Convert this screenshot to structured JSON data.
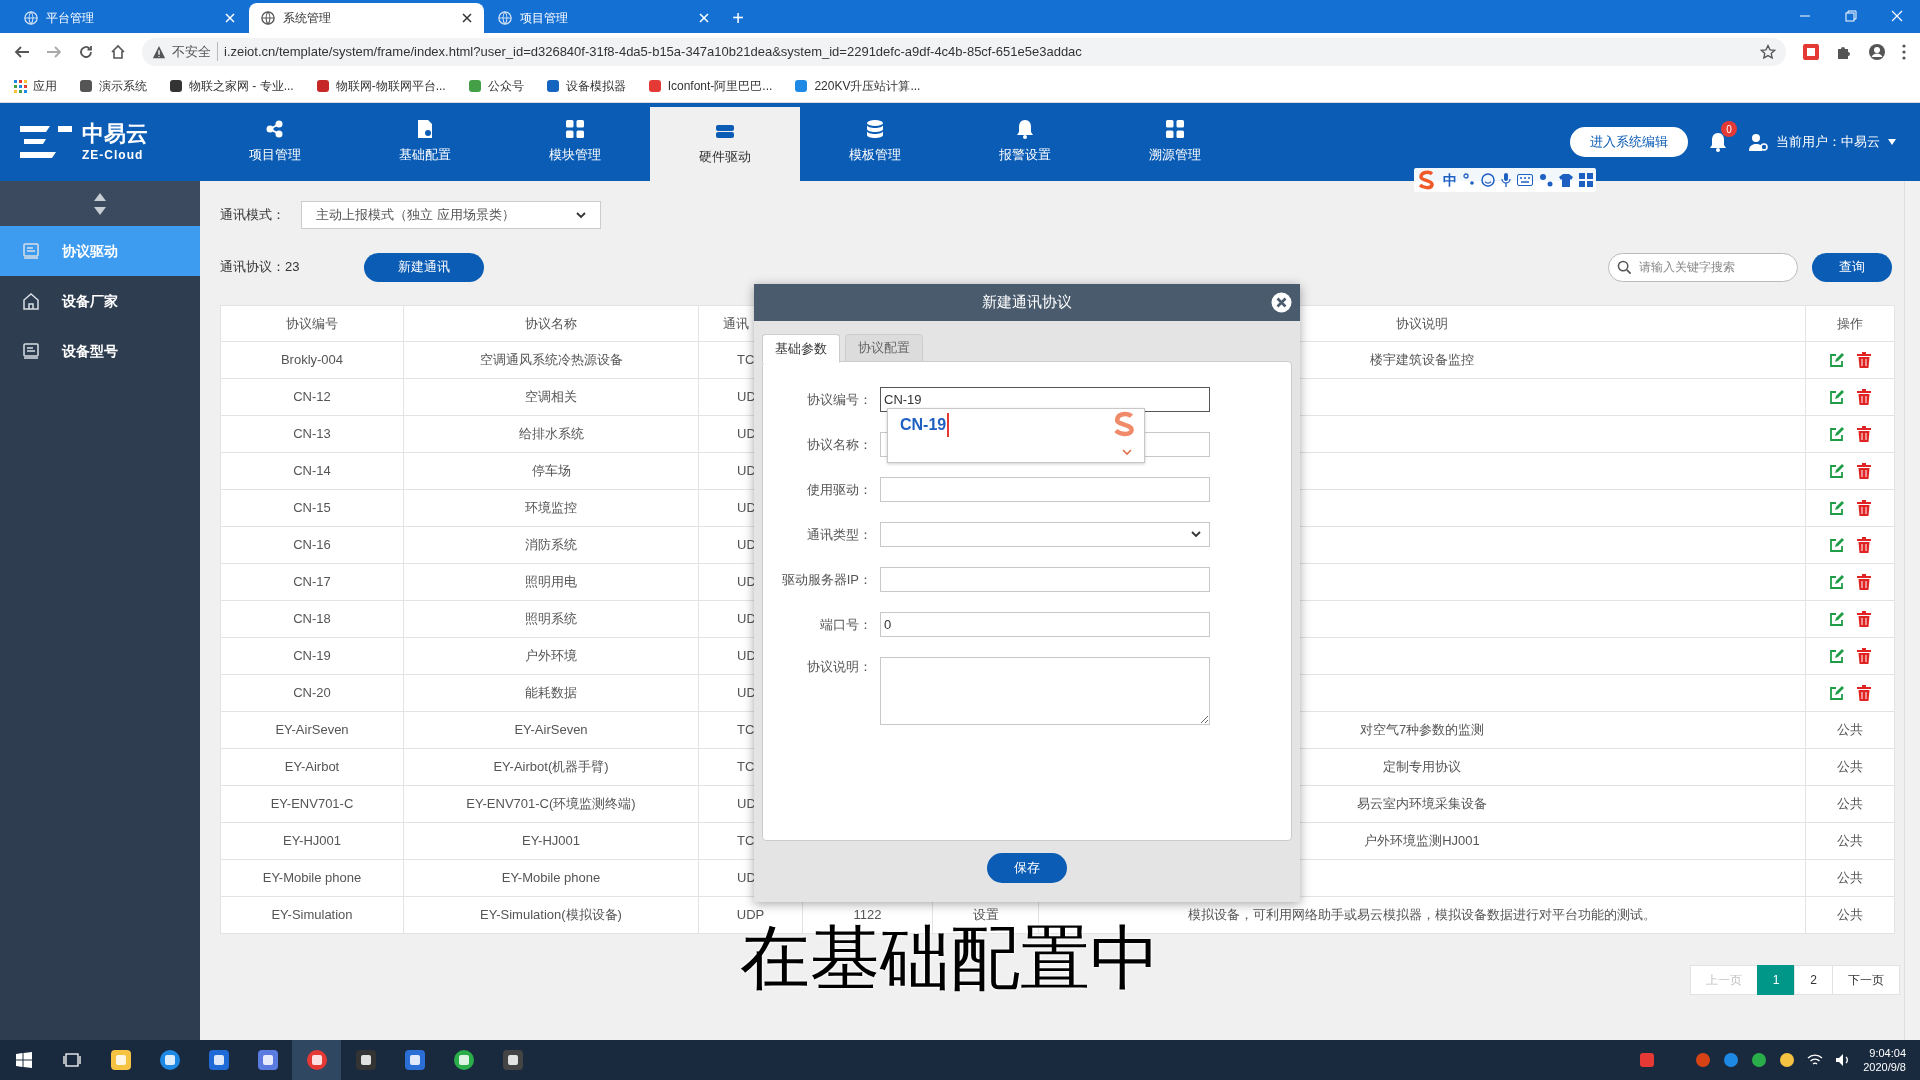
{
  "browser": {
    "tabs": [
      {
        "title": "平台管理",
        "selected": false
      },
      {
        "title": "系统管理",
        "selected": true
      },
      {
        "title": "项目管理",
        "selected": false
      }
    ],
    "new_tab": "+",
    "security_label": "不安全",
    "url": "i.zeiot.cn/template/system/frame/index.html?user_id=d326840f-31f8-4da5-b15a-347a10b21dea&system_id=2291defc-a9df-4c4b-85cf-651e5e3addac",
    "bookmarks": [
      {
        "label": "应用"
      },
      {
        "label": "演示系统"
      },
      {
        "label": "物联之家网 - 专业..."
      },
      {
        "label": "物联网-物联网平台..."
      },
      {
        "label": "公众号"
      },
      {
        "label": "设备模拟器"
      },
      {
        "label": "Iconfont-阿里巴巴..."
      },
      {
        "label": "220KV升压站计算..."
      }
    ]
  },
  "app": {
    "logo_name": "中易云",
    "logo_subtitle": "ZE-Cloud",
    "nav": [
      {
        "label": "项目管理",
        "selected": false
      },
      {
        "label": "基础配置",
        "selected": false
      },
      {
        "label": "模块管理",
        "selected": false
      },
      {
        "label": "硬件驱动",
        "selected": true
      },
      {
        "label": "模板管理",
        "selected": false
      },
      {
        "label": "报警设置",
        "selected": false
      },
      {
        "label": "溯源管理",
        "selected": false
      }
    ],
    "edit_button": "进入系统编辑",
    "notification_count": "0",
    "user_label": "当前用户：中易云"
  },
  "ime_toolbar": {
    "mode": "中"
  },
  "sidebar": {
    "items": [
      {
        "label": "协议驱动",
        "selected": true
      },
      {
        "label": "设备厂家",
        "selected": false
      },
      {
        "label": "设备型号",
        "selected": false
      }
    ]
  },
  "toolbar": {
    "mode_label": "通讯模式：",
    "mode_value": "主动上报模式（独立 应用场景类）",
    "count_label": "通讯协议：23",
    "new_button": "新建通讯",
    "search_placeholder": "请输入关键字搜索",
    "search_button": "查询"
  },
  "table": {
    "columns": [
      "协议编号",
      "协议名称",
      "通讯",
      "协议说明",
      "操作"
    ],
    "rows": [
      {
        "code": "Brokly-004",
        "name": "空调通风系统冷热源设备",
        "column_3": "TC",
        "description": "楼宇建筑设备监控",
        "action": {
          "kind": "icons"
        }
      },
      {
        "code": "CN-12",
        "name": "空调相关",
        "column_3": "UD",
        "action": {
          "kind": "icons"
        }
      },
      {
        "code": "CN-13",
        "name": "给排水系统",
        "column_3": "UD",
        "action": {
          "kind": "icons"
        }
      },
      {
        "code": "CN-14",
        "name": "停车场",
        "column_3": "UD",
        "action": {
          "kind": "icons"
        }
      },
      {
        "code": "CN-15",
        "name": "环境监控",
        "column_3": "UD",
        "action": {
          "kind": "icons"
        }
      },
      {
        "code": "CN-16",
        "name": "消防系统",
        "column_3": "UD",
        "action": {
          "kind": "icons"
        }
      },
      {
        "code": "CN-17",
        "name": "照明用电",
        "column_3": "UD",
        "action": {
          "kind": "icons"
        }
      },
      {
        "code": "CN-18",
        "name": "照明系统",
        "column_3": "UD",
        "action": {
          "kind": "icons"
        }
      },
      {
        "code": "CN-19",
        "name": "户外环境",
        "column_3": "UD",
        "action": {
          "kind": "icons"
        }
      },
      {
        "code": "CN-20",
        "name": "能耗数据",
        "column_3": "UD",
        "action": {
          "kind": "icons"
        }
      },
      {
        "code": "EY-AirSeven",
        "name": "EY-AirSeven",
        "column_3": "TC",
        "description": "对空气7种参数的监测",
        "action": {
          "kind": "text",
          "label": "公共"
        }
      },
      {
        "code": "EY-Airbot",
        "name": "EY-Airbot(机器手臂)",
        "column_3": "TC",
        "description": "定制专用协议",
        "action": {
          "kind": "text",
          "label": "公共"
        }
      },
      {
        "code": "EY-ENV701-C",
        "name": "EY-ENV701-C(环境监测终端)",
        "column_3": "UD",
        "description": "易云室内环境采集设备",
        "action": {
          "kind": "text",
          "label": "公共"
        }
      },
      {
        "code": "EY-HJ001",
        "name": "EY-HJ001",
        "column_3": "TC",
        "description": "户外环境监测HJ001",
        "action": {
          "kind": "text",
          "label": "公共"
        }
      },
      {
        "code": "EY-Mobile phone",
        "name": "EY-Mobile phone",
        "column_3": "UD",
        "action": {
          "kind": "text",
          "label": "公共"
        }
      },
      {
        "code": "EY-Simulation",
        "name": "EY-Simulation(模拟设备)",
        "column_3": "UDP",
        "column_4": "1122",
        "column_5": "设置",
        "description": "模拟设备，可利用网络助手或易云模拟器，模拟设备数据进行对平台功能的测试。",
        "action": {
          "kind": "text",
          "label": "公共"
        }
      }
    ]
  },
  "pagination": [
    {
      "label": "上一页",
      "selected": false,
      "disabled": true
    },
    {
      "label": "1",
      "selected": true,
      "disabled": false
    },
    {
      "label": "2",
      "selected": false,
      "disabled": false
    },
    {
      "label": "下一页",
      "selected": false,
      "disabled": false
    }
  ],
  "dialog": {
    "title": "新建通讯协议",
    "tabs": [
      {
        "label": "基础参数",
        "selected": true
      },
      {
        "label": "协议配置",
        "selected": false
      }
    ],
    "fields": [
      {
        "label": "协议编号：",
        "kind": "input",
        "value": "CN-19",
        "focused": true
      },
      {
        "label": "协议名称：",
        "kind": "input",
        "focused": false
      },
      {
        "label": "使用驱动：",
        "kind": "input",
        "focused": false
      },
      {
        "label": "通讯类型：",
        "kind": "select",
        "focused": false
      },
      {
        "label": "驱动服务器IP：",
        "kind": "input",
        "focused": false
      },
      {
        "label": "端口号：",
        "kind": "input",
        "value": "0",
        "focused": false
      },
      {
        "label": "协议说明：",
        "kind": "textarea",
        "focused": false
      }
    ],
    "save_button": "保存"
  },
  "ime_candidate": {
    "text": "CN-19"
  },
  "subtitle": "在基础配置中",
  "taskbar": {
    "time": "9:04:04",
    "date": "2020/9/8"
  }
}
